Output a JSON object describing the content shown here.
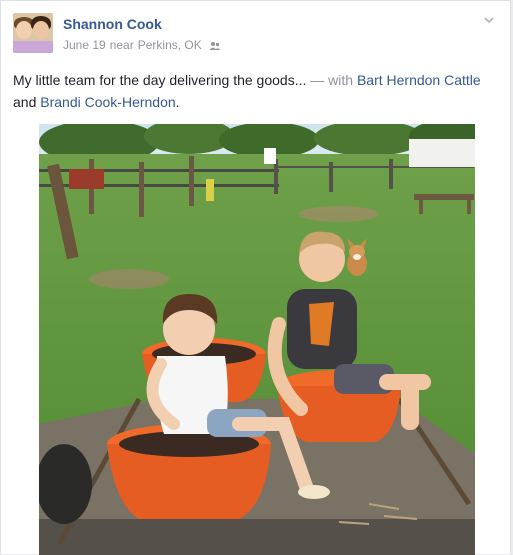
{
  "post": {
    "author": "Shannon Cook",
    "date": "June 19",
    "near_text": "near",
    "location": "Perkins, OK",
    "caption_text": "My little team for the day delivering the goods...",
    "with_text": "— with",
    "tagged_1": "Bart Herndon Cattle",
    "and_text": "and",
    "tagged_2": "Brandi Cook-Herndon",
    "period": "."
  },
  "icons": {
    "audience": "friends-icon",
    "menu": "chevron-down-icon"
  },
  "colors": {
    "link": "#365899",
    "meta": "#90949c",
    "text": "#1d2129"
  }
}
